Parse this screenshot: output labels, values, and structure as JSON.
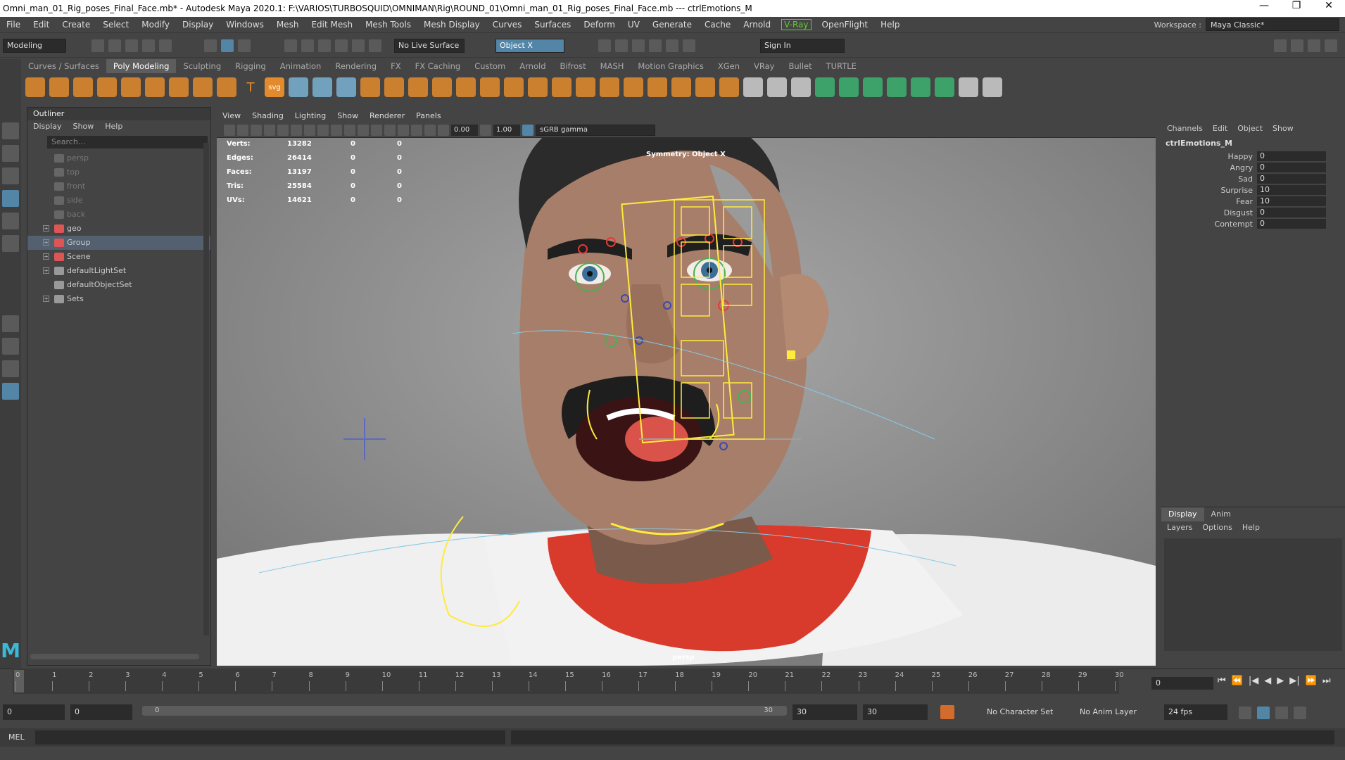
{
  "window": {
    "title": "Omni_man_01_Rig_poses_Final_Face.mb* - Autodesk Maya 2020.1: F:\\VARIOS\\TURBOSQUID\\OMNIMAN\\Rig\\ROUND_01\\Omni_man_01_Rig_poses_Final_Face.mb  ---  ctrlEmotions_M",
    "minimize": "—",
    "restore": "❐",
    "close": "✕"
  },
  "menubar": {
    "items": [
      "File",
      "Edit",
      "Create",
      "Select",
      "Modify",
      "Display",
      "Windows",
      "Mesh",
      "Edit Mesh",
      "Mesh Tools",
      "Mesh Display",
      "Curves",
      "Surfaces",
      "Deform",
      "UV",
      "Generate",
      "Cache",
      "Arnold"
    ],
    "vray": "V-Ray",
    "items2": [
      "OpenFlight",
      "Help"
    ],
    "workspace_label": "Workspace :",
    "workspace_value": "Maya Classic*"
  },
  "statusline": {
    "mode": "Modeling",
    "live_surface": "No Live Surface",
    "symmetry": "Object X",
    "sign_in": "Sign In"
  },
  "shelf": {
    "tabs": [
      "Curves / Surfaces",
      "Poly Modeling",
      "Sculpting",
      "Rigging",
      "Animation",
      "Rendering",
      "FX",
      "FX Caching",
      "Custom",
      "Arnold",
      "Bifrost",
      "MASH",
      "Motion Graphics",
      "XGen",
      "VRay",
      "Bullet",
      "TURTLE"
    ],
    "active_tab": "Poly Modeling",
    "text_icon": "T",
    "svg_icon": "svg"
  },
  "outliner": {
    "title": "Outliner",
    "menu": [
      "Display",
      "Show",
      "Help"
    ],
    "search_placeholder": "Search...",
    "items": [
      {
        "label": "persp",
        "dim": true,
        "expand": ""
      },
      {
        "label": "top",
        "dim": true,
        "expand": ""
      },
      {
        "label": "front",
        "dim": true,
        "expand": ""
      },
      {
        "label": "side",
        "dim": true,
        "expand": ""
      },
      {
        "label": "back",
        "dim": true,
        "expand": ""
      },
      {
        "label": "geo",
        "dim": false,
        "expand": "+"
      },
      {
        "label": "Group",
        "dim": false,
        "expand": "+"
      },
      {
        "label": "Scene",
        "dim": false,
        "expand": "+"
      },
      {
        "label": "defaultLightSet",
        "dim": false,
        "expand": "+"
      },
      {
        "label": "defaultObjectSet",
        "dim": false,
        "expand": ""
      },
      {
        "label": "Sets",
        "dim": false,
        "expand": "+"
      }
    ],
    "selected": "Group"
  },
  "viewport": {
    "menu": [
      "View",
      "Shading",
      "Lighting",
      "Show",
      "Renderer",
      "Panels"
    ],
    "exposure": "0.00",
    "gamma": "1.00",
    "color_space": "sGRB gamma",
    "symmetry_label": "Symmetry: Object X",
    "camera_label": "persp",
    "hud": [
      {
        "k": "Verts:",
        "v": "13282",
        "a": "0",
        "b": "0"
      },
      {
        "k": "Edges:",
        "v": "26414",
        "a": "0",
        "b": "0"
      },
      {
        "k": "Faces:",
        "v": "13197",
        "a": "0",
        "b": "0"
      },
      {
        "k": "Tris:",
        "v": "25584",
        "a": "0",
        "b": "0"
      },
      {
        "k": "UVs:",
        "v": "14621",
        "a": "0",
        "b": "0"
      }
    ]
  },
  "channelbox": {
    "menu": [
      "Channels",
      "Edit",
      "Object",
      "Show"
    ],
    "node": "ctrlEmotions_M",
    "attrs": [
      {
        "name": "Happy",
        "value": "0"
      },
      {
        "name": "Angry",
        "value": "0"
      },
      {
        "name": "Sad",
        "value": "0"
      },
      {
        "name": "Surprise",
        "value": "10"
      },
      {
        "name": "Fear",
        "value": "10"
      },
      {
        "name": "Disgust",
        "value": "0"
      },
      {
        "name": "Contempt",
        "value": "0"
      }
    ]
  },
  "layers": {
    "tabs": [
      "Display",
      "Anim"
    ],
    "menu": [
      "Layers",
      "Options",
      "Help"
    ]
  },
  "timeline": {
    "ticks": [
      "0",
      "1",
      "2",
      "3",
      "4",
      "5",
      "6",
      "7",
      "8",
      "9",
      "10",
      "11",
      "12",
      "13",
      "14",
      "15",
      "16",
      "17",
      "18",
      "19",
      "20",
      "21",
      "22",
      "23",
      "24",
      "25",
      "26",
      "27",
      "28",
      "29",
      "30"
    ],
    "current_frame": "0",
    "playback_icons": [
      "⏮",
      "⏪",
      "|◀",
      "◀",
      "▶",
      "▶|",
      "⏩",
      "⏭"
    ]
  },
  "range": {
    "start": "0",
    "anim_start": "0",
    "bar_start": "0",
    "bar_end": "30",
    "anim_end": "30",
    "end": "30",
    "character_set": "No Character Set",
    "anim_layer": "No Anim Layer",
    "fps": "24 fps"
  },
  "cmdline": {
    "label": "MEL"
  }
}
